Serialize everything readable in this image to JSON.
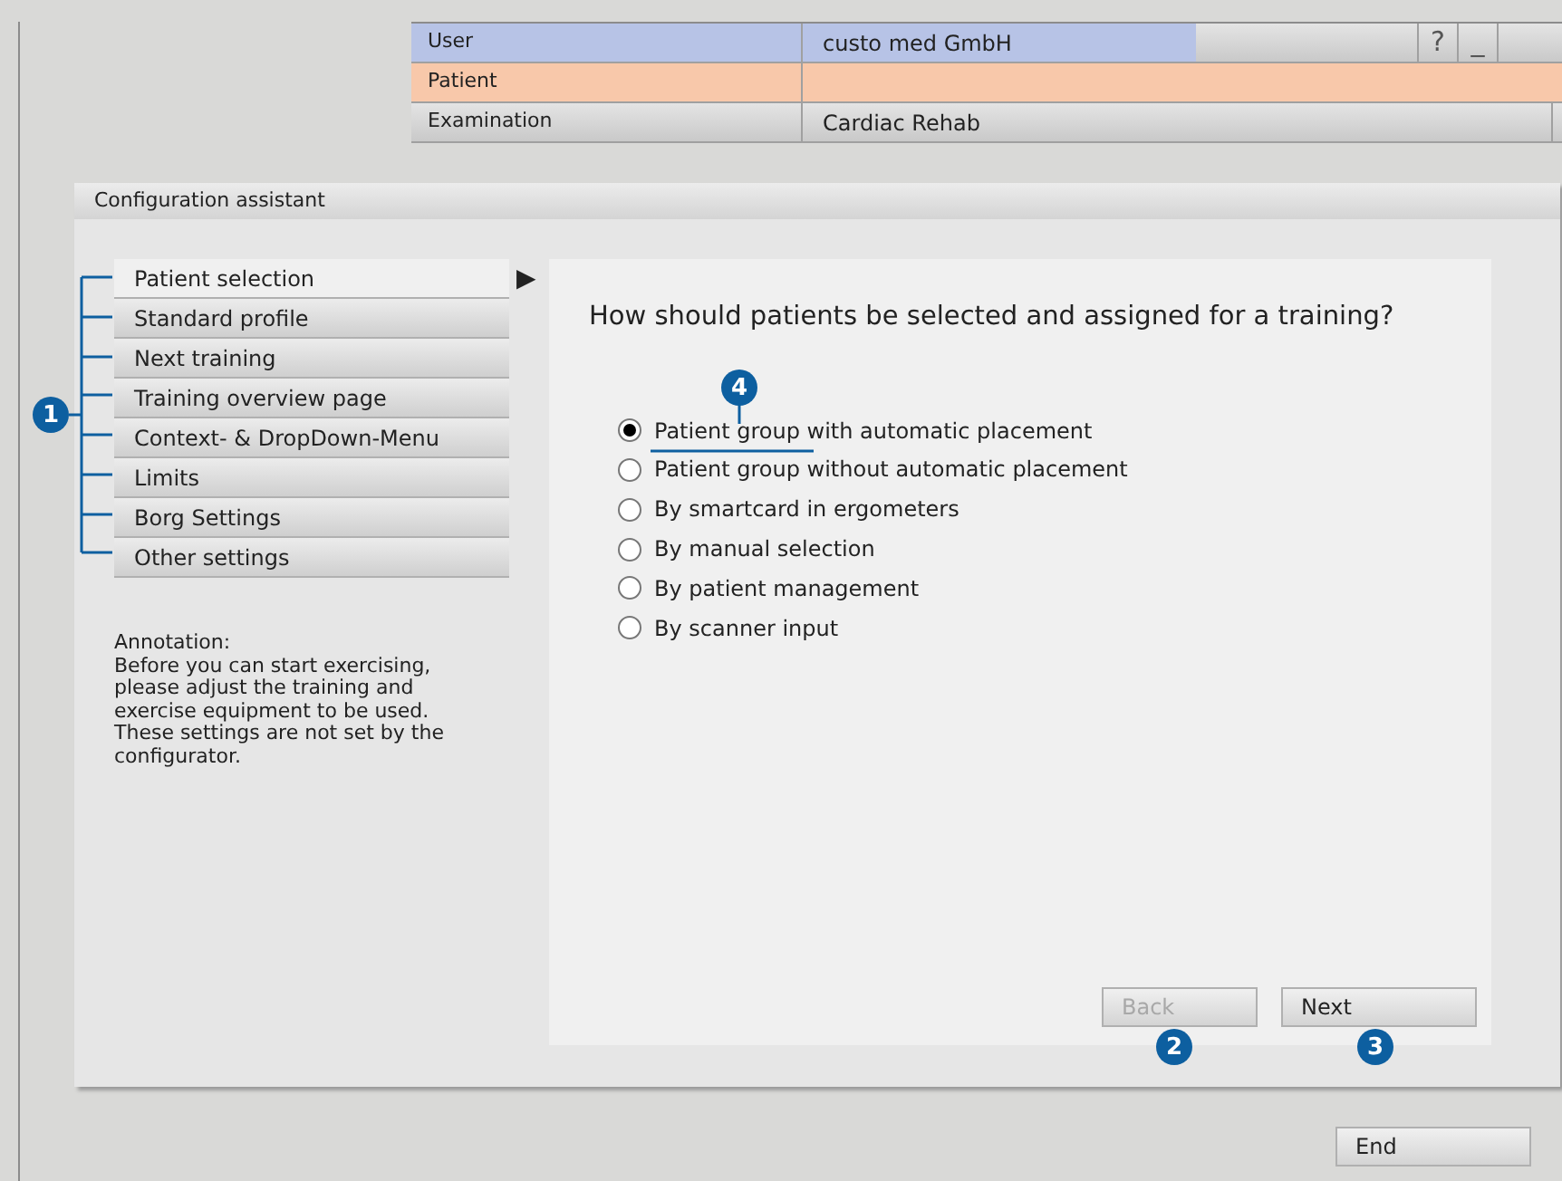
{
  "top_bar": {
    "rows": [
      {
        "kind": "user",
        "label": "User",
        "value": "custo med GmbH"
      },
      {
        "kind": "patient",
        "label": "Patient"
      },
      {
        "kind": "exam",
        "label": "Examination",
        "value": "Cardiac Rehab"
      }
    ],
    "window_controls": [
      "?",
      "_"
    ]
  },
  "dialog": {
    "title": "Configuration assistant",
    "nav_items": [
      {
        "label": "Patient selection",
        "selected": true
      },
      {
        "label": "Standard profile",
        "selected": false
      },
      {
        "label": "Next training",
        "selected": false
      },
      {
        "label": "Training overview page",
        "selected": false
      },
      {
        "label": "Context- & DropDown-Menu",
        "selected": false
      },
      {
        "label": "Limits",
        "selected": false
      },
      {
        "label": "Borg Settings",
        "selected": false
      },
      {
        "label": "Other settings",
        "selected": false
      }
    ],
    "selection_arrow": "▶",
    "annotation": {
      "title": "Annotation:",
      "text": "Before you can start exercising, please adjust the training and exercise equipment to be used. These settings are not set by the configurator."
    },
    "question": "How should patients be selected and assigned for a training?",
    "options": [
      {
        "label": "Patient group with automatic placement",
        "selected": true
      },
      {
        "label": "Patient group without automatic placement",
        "selected": false
      },
      {
        "label": "By smartcard in ergometers",
        "selected": false
      },
      {
        "label": "By manual selection",
        "selected": false
      },
      {
        "label": "By patient management",
        "selected": false
      },
      {
        "label": "By scanner input",
        "selected": false
      }
    ],
    "buttons": [
      {
        "label": "Back",
        "disabled": true
      },
      {
        "label": "Next",
        "disabled": false
      }
    ]
  },
  "end_button": "End",
  "callouts": [
    "1",
    "2",
    "3",
    "4"
  ]
}
